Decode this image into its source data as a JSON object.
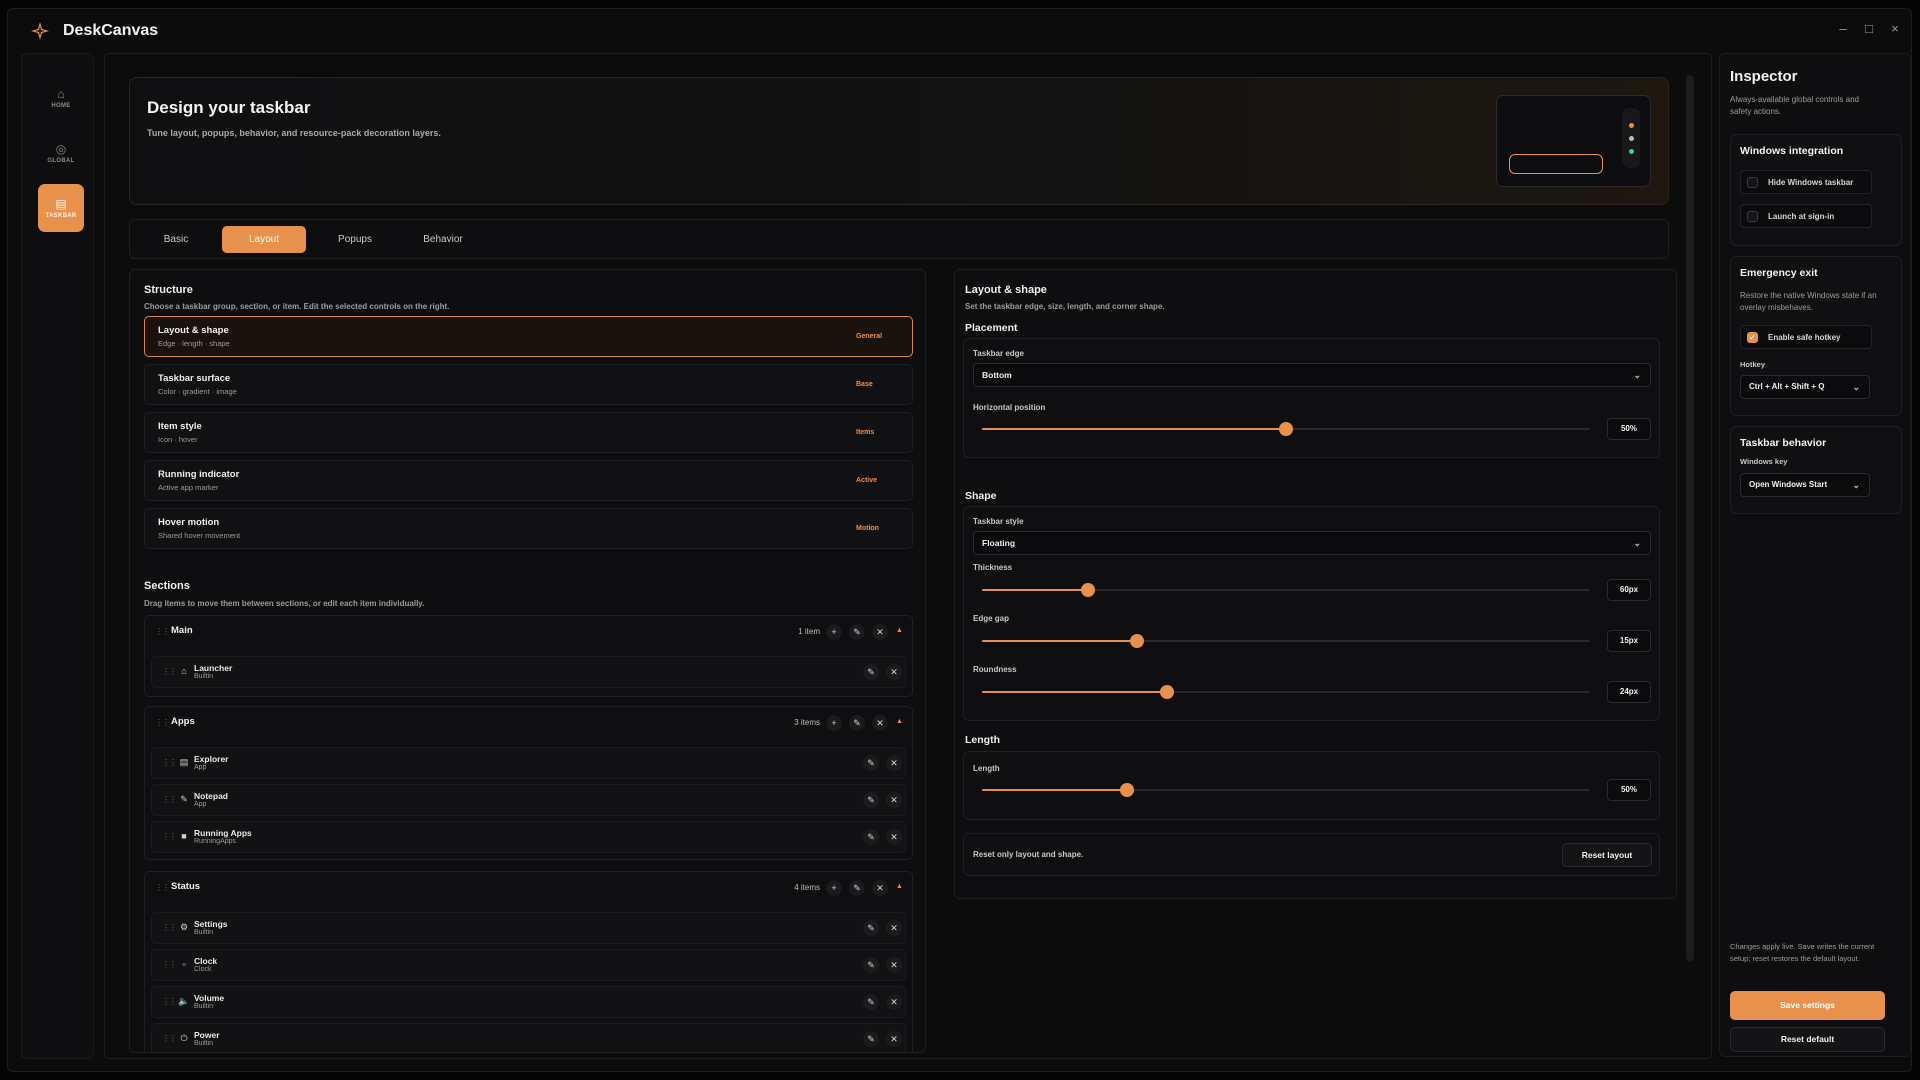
{
  "app": {
    "title": "DeskCanvas",
    "min_label": "–",
    "max_label": "□",
    "close_label": "×"
  },
  "rail": {
    "items": [
      {
        "label": "HOME",
        "icon": "home-icon",
        "glyph": "⌂"
      },
      {
        "label": "GLOBAL",
        "icon": "globe-icon",
        "glyph": "◎"
      },
      {
        "label": "TASKBAR",
        "icon": "taskbar-icon",
        "glyph": "▤"
      }
    ]
  },
  "hero": {
    "title": "Design your taskbar",
    "subtitle": "Tune layout, popups, behavior, and resource-pack decoration layers."
  },
  "tabs": [
    {
      "label": "Basic"
    },
    {
      "label": "Layout"
    },
    {
      "label": "Popups"
    },
    {
      "label": "Behavior"
    }
  ],
  "structure": {
    "title": "Structure",
    "subtitle": "Choose a taskbar group, section, or item. Edit the selected controls on the right.",
    "rows": [
      {
        "title": "Layout & shape",
        "sub": "Edge · length · shape",
        "tag": "General"
      },
      {
        "title": "Taskbar surface",
        "sub": "Color · gradient · image",
        "tag": "Base"
      },
      {
        "title": "Item style",
        "sub": "Icon · hover",
        "tag": "Items"
      },
      {
        "title": "Running indicator",
        "sub": "Active app marker",
        "tag": "Active"
      },
      {
        "title": "Hover motion",
        "sub": "Shared hover movement",
        "tag": "Motion"
      }
    ]
  },
  "sections": {
    "title": "Sections",
    "subtitle": "Drag items to move them between sections, or edit each item individually.",
    "groups": [
      {
        "name": "Main",
        "count": "1 item",
        "items": [
          {
            "name": "Launcher",
            "type": "Builtin",
            "glyph": "⌂"
          }
        ]
      },
      {
        "name": "Apps",
        "count": "3 items",
        "items": [
          {
            "name": "Explorer",
            "type": "App",
            "glyph": "▤"
          },
          {
            "name": "Notepad",
            "type": "App",
            "glyph": "✎"
          },
          {
            "name": "Running Apps",
            "type": "RunningApps",
            "glyph": "■"
          }
        ]
      },
      {
        "name": "Status",
        "count": "4 items",
        "items": [
          {
            "name": "Settings",
            "type": "Builtin",
            "glyph": "⚙"
          },
          {
            "name": "Clock",
            "type": "Clock",
            "glyph": "▫"
          },
          {
            "name": "Volume",
            "type": "Builtin",
            "glyph": "🔈"
          },
          {
            "name": "Power",
            "type": "Builtin",
            "glyph": "⏻"
          }
        ]
      }
    ]
  },
  "layout_shape": {
    "title": "Layout & shape",
    "subtitle": "Set the taskbar edge, size, length, and corner shape.",
    "placement": {
      "title": "Placement",
      "edge_label": "Taskbar edge",
      "edge_value": "Bottom",
      "hpos_label": "Horizontal position",
      "hpos_value": "50%",
      "hpos_fraction": 0.5
    },
    "shape": {
      "title": "Shape",
      "style_label": "Taskbar style",
      "style_value": "Floating",
      "thickness_label": "Thickness",
      "thickness_value": "60px",
      "thickness_fraction": 0.175,
      "gap_label": "Edge gap",
      "gap_value": "15px",
      "gap_fraction": 0.255,
      "round_label": "Roundness",
      "round_value": "24px",
      "round_fraction": 0.305
    },
    "length": {
      "title": "Length",
      "label": "Length",
      "value": "50%",
      "fraction": 0.238
    },
    "reset_note": "Reset only layout and shape.",
    "reset_button": "Reset layout"
  },
  "inspector": {
    "title": "Inspector",
    "subtitle": "Always-available global controls and safety actions.",
    "windows": {
      "title": "Windows integration",
      "hide": "Hide Windows taskbar",
      "launch": "Launch at sign-in"
    },
    "emergency": {
      "title": "Emergency exit",
      "desc": "Restore the native Windows state if an overlay misbehaves.",
      "hotkey_toggle": "Enable safe hotkey",
      "hotkey_label": "Hotkey",
      "hotkey_value": "Ctrl + Alt + Shift + Q"
    },
    "behavior": {
      "title": "Taskbar behavior",
      "key_label": "Windows key",
      "key_value": "Open Windows Start"
    },
    "footer_note": "Changes apply live. Save writes the current setup; reset restores the default layout.",
    "save": "Save settings",
    "reset": "Reset default"
  },
  "colors": {
    "accent": "#e8914c",
    "bg": "#0b0b0c",
    "success": "#3ecf8e"
  }
}
